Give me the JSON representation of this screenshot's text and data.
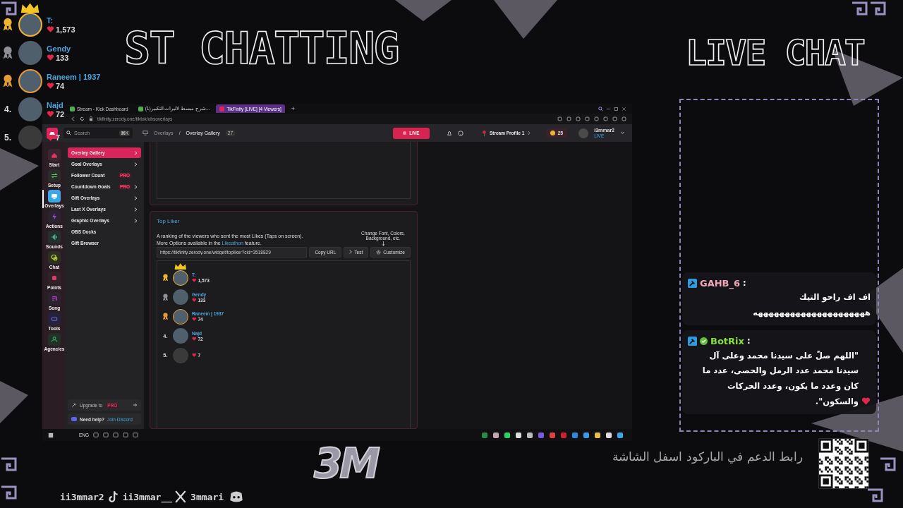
{
  "overlay_titles": [
    {
      "text": "ST CHATTING"
    },
    {
      "text": "LIVE CHAT"
    }
  ],
  "top_liker_overlay": {
    "entries": [
      {
        "kind": "medal",
        "color": "#f0b530",
        "ring": true,
        "crown": true,
        "name": "T:",
        "likes": "1,573"
      },
      {
        "kind": "medal",
        "color": "#8f8f95",
        "ring": false,
        "crown": false,
        "name": "Gendy",
        "likes": "133"
      },
      {
        "kind": "medal",
        "color": "#e59a3a",
        "ring": true,
        "crown": false,
        "name": "Raneem | 1937",
        "likes": "74"
      },
      {
        "kind": "number",
        "rank": "4.",
        "ring": false,
        "crown": false,
        "name": "Najd",
        "likes": "72"
      },
      {
        "kind": "number",
        "rank": "5.",
        "ring": false,
        "crown": false,
        "likes": "7"
      }
    ]
  },
  "browser": {
    "tabs": [
      {
        "label": "Stream - Kick Dashboard",
        "selected": false
      },
      {
        "label": "(1)شرح مبسط لاليرات التكبير...",
        "selected": false
      },
      {
        "label": "TikFinity [LIVE] [4 Viewers]",
        "selected": true
      }
    ],
    "new_tab": "+",
    "address": "tikfinity.zerody.one/tiktok/obsoverlays"
  },
  "app_header": {
    "search": {
      "placeholder": "Search",
      "shortcut": "⌘K"
    },
    "breadcrumb": [
      "Overlays",
      "Overlay Gallery"
    ],
    "breadcrumb_separator": "/",
    "count": "27",
    "live_button": "LIVE",
    "profile": "Stream Profile 1",
    "coins": "25",
    "user": {
      "name": "i3mmar2",
      "status": "LIVE"
    }
  },
  "rail": [
    {
      "label": "Start",
      "selected": false
    },
    {
      "label": "Setup",
      "selected": false
    },
    {
      "label": "Overlays",
      "selected": true
    },
    {
      "label": "Actions",
      "selected": false
    },
    {
      "label": "Sounds",
      "selected": false
    },
    {
      "label": "Chat",
      "selected": false
    },
    {
      "label": "Points",
      "selected": false
    },
    {
      "label": "Song",
      "selected": false
    },
    {
      "label": "Tools",
      "selected": false
    },
    {
      "label": "Agencies",
      "selected": false
    }
  ],
  "menu": {
    "items": [
      {
        "label": "Overlay Gallery",
        "selected": true,
        "submenu": true
      },
      {
        "label": "Goal Overlays",
        "selected": false,
        "submenu": true
      },
      {
        "label": "Follower Count",
        "selected": false,
        "submenu": false,
        "badge": "PRO"
      },
      {
        "label": "Countdown Goals",
        "selected": false,
        "submenu": true,
        "badge": "PRO"
      },
      {
        "label": "Gift Overlays",
        "selected": false,
        "submenu": true
      },
      {
        "label": "Last X Overlays",
        "selected": false,
        "submenu": true
      },
      {
        "label": "Graphic Overlays",
        "selected": false,
        "submenu": true
      },
      {
        "label": "OBS Docks",
        "selected": false,
        "submenu": false
      },
      {
        "label": "Gift Browser",
        "selected": false,
        "submenu": false
      }
    ],
    "upgrade": {
      "label": "Upgrade to",
      "badge": "PRO"
    },
    "help": {
      "text": "Need help?",
      "link": "Join Discord"
    }
  },
  "widget": {
    "title": "Top Liker",
    "description": "A ranking of the viewers who sent the most Likes (Taps on screen).",
    "options": {
      "before": "More Options available in the",
      "link": "Likeathon",
      "after": "feature."
    },
    "hint": "Change Font, Colors, Background, etc.",
    "url": "https://tikfinity.zerody.one/widget/topliker?cid=3518829",
    "buttons": [
      {
        "label": "Copy URL",
        "kind": "plain"
      },
      {
        "label": "Test",
        "kind": "chevron"
      },
      {
        "label": "Customize",
        "kind": "gear"
      }
    ],
    "preview": [
      {
        "kind": "medal",
        "color": "#f0b530",
        "ring": true,
        "crown": true,
        "name": "T:",
        "likes": "1,573"
      },
      {
        "kind": "medal",
        "color": "#8f8f95",
        "ring": false,
        "crown": false,
        "name": "Gendy",
        "likes": "133"
      },
      {
        "kind": "medal",
        "color": "#e59a3a",
        "ring": true,
        "crown": false,
        "name": "Raneem | 1937",
        "likes": "74"
      },
      {
        "kind": "number",
        "rank": "4.",
        "ring": false,
        "crown": false,
        "name": "Najd",
        "likes": "72"
      },
      {
        "kind": "number",
        "rank": "5.",
        "ring": false,
        "crown": false,
        "likes": "7"
      }
    ]
  },
  "taskbar": {
    "language": "ENG"
  },
  "chat": {
    "messages": [
      {
        "user": "GAHB_6",
        "color": "#f2a6b8",
        "verified": false,
        "heart": false,
        "separator": ":",
        "text": "اف اف راحو التيك هههههههههههههههههههههه"
      },
      {
        "user": "BotRix",
        "color": "#86e03c",
        "verified": true,
        "heart": true,
        "separator": ":",
        "text": "\"اللهم صلّ على سيدنا محمد وعلى آل سيدنا محمد عدد الرمل والحصى، عدد ما كان وعدد ما يكون، وعدد الحركات والسكون\"."
      }
    ]
  },
  "footer": {
    "logo": "3M",
    "socials": [
      {
        "handle": "ii3mmar2",
        "kind": "tiktok"
      },
      {
        "handle": "ii3mmar__",
        "kind": "x"
      },
      {
        "handle": "3mmari",
        "kind": "discord"
      }
    ],
    "support_text": "رابط الدعم في الباركود اسفل الشاشة"
  }
}
